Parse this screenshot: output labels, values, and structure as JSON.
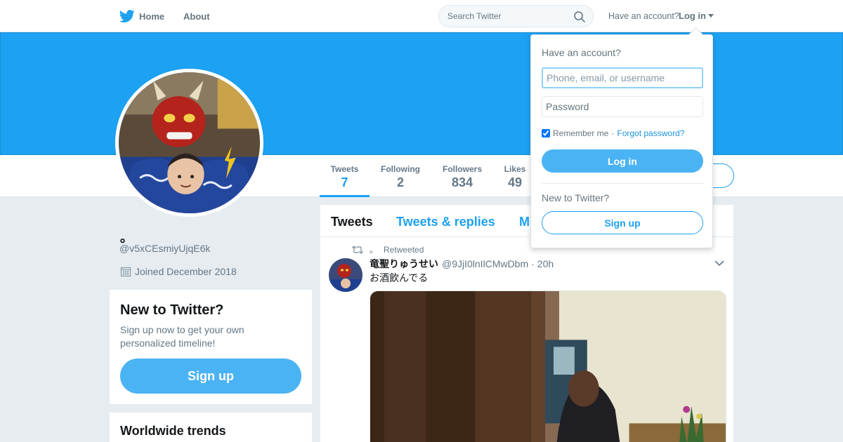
{
  "topnav": {
    "home_label": "Home",
    "about_label": "About",
    "search_placeholder": "Search Twitter",
    "have_account": "Have an account?",
    "login_label": "Log in",
    "brand_color": "#1da1f2"
  },
  "profile": {
    "screen_name": "。",
    "handle": "@v5xCEsmiyUjqE6k",
    "joined": "Joined December 2018",
    "banner_color": "#1da1f2"
  },
  "stats": [
    {
      "label": "Tweets",
      "value": "7"
    },
    {
      "label": "Following",
      "value": "2"
    },
    {
      "label": "Followers",
      "value": "834"
    },
    {
      "label": "Likes",
      "value": "49"
    }
  ],
  "signup_card": {
    "title": "New to Twitter?",
    "subtitle": "Sign up now to get your own personalized timeline!",
    "button": "Sign up"
  },
  "trends": {
    "title": "Worldwide trends"
  },
  "timeline": {
    "tabs": [
      {
        "label": "Tweets"
      },
      {
        "label": "Tweets & replies"
      },
      {
        "label": "M"
      }
    ],
    "tweet": {
      "retweeted_by": "。",
      "retweeted_label": "Retweeted",
      "fullname": "竜聖りゅうせい",
      "username": "@9JjI0lnIlCMwDbm",
      "dot": "·",
      "time": "20h",
      "text": "お酒飲んでる"
    }
  },
  "login_dropdown": {
    "title": "Have an account?",
    "username_placeholder": "Phone, email, or username",
    "password_placeholder": "Password",
    "remember_label": "Remember me",
    "separator": "·",
    "forgot_label": "Forgot password?",
    "login_button": "Log in",
    "new_label": "New to Twitter?",
    "signup_button": "Sign up"
  }
}
